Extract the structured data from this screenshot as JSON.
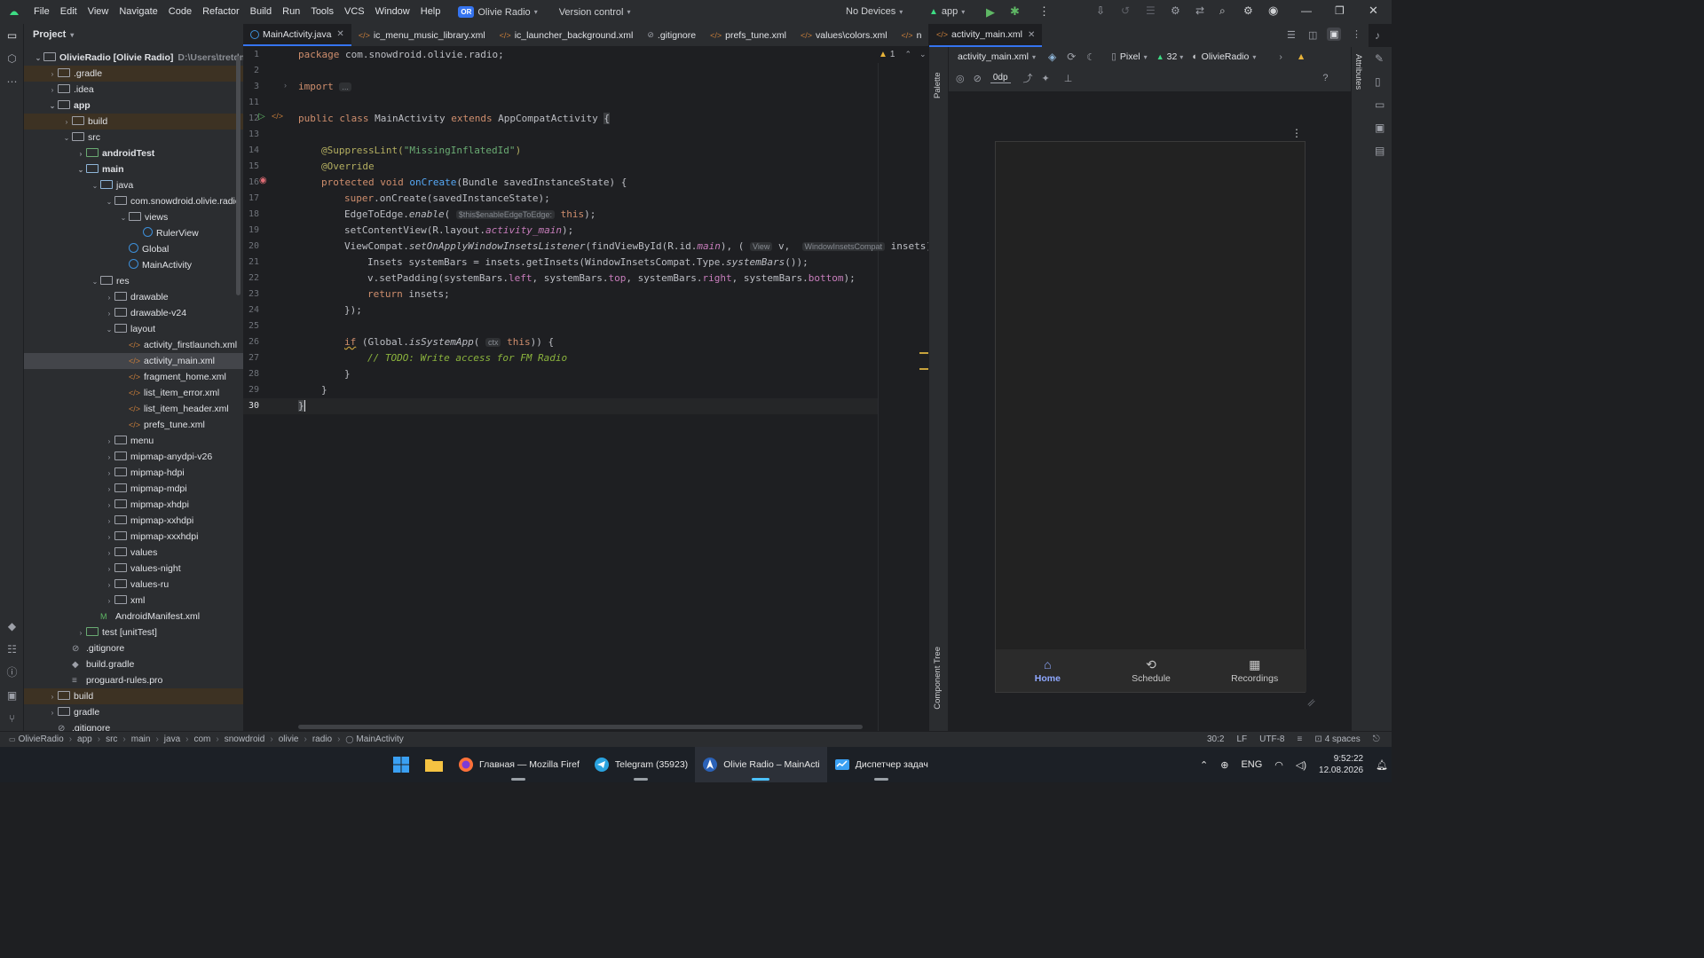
{
  "menu": [
    "File",
    "Edit",
    "View",
    "Navigate",
    "Code",
    "Refactor",
    "Build",
    "Run",
    "Tools",
    "VCS",
    "Window",
    "Help"
  ],
  "project_badge": "OR",
  "project_name": "Olivie Radio",
  "version_control": "Version control",
  "devices": "No Devices",
  "run_config": "app",
  "project_panel": {
    "title": "Project",
    "rows": [
      {
        "label": "OlivieRadio [Olivie Radio]",
        "extra": "D:\\Users\\tretdm\\So"
      },
      {
        "label": ".gradle"
      },
      {
        "label": ".idea"
      },
      {
        "label": "app"
      },
      {
        "label": "build"
      },
      {
        "label": "src"
      },
      {
        "label": "androidTest"
      },
      {
        "label": "main"
      },
      {
        "label": "java"
      },
      {
        "label": "com.snowdroid.olivie.radio"
      },
      {
        "label": "views"
      },
      {
        "label": "RulerView"
      },
      {
        "label": "Global"
      },
      {
        "label": "MainActivity"
      },
      {
        "label": "res"
      },
      {
        "label": "drawable"
      },
      {
        "label": "drawable-v24"
      },
      {
        "label": "layout"
      },
      {
        "label": "activity_firstlaunch.xml"
      },
      {
        "label": "activity_main.xml"
      },
      {
        "label": "fragment_home.xml"
      },
      {
        "label": "list_item_error.xml"
      },
      {
        "label": "list_item_header.xml"
      },
      {
        "label": "prefs_tune.xml"
      },
      {
        "label": "menu"
      },
      {
        "label": "mipmap-anydpi-v26"
      },
      {
        "label": "mipmap-hdpi"
      },
      {
        "label": "mipmap-mdpi"
      },
      {
        "label": "mipmap-xhdpi"
      },
      {
        "label": "mipmap-xxhdpi"
      },
      {
        "label": "mipmap-xxxhdpi"
      },
      {
        "label": "values"
      },
      {
        "label": "values-night"
      },
      {
        "label": "values-ru"
      },
      {
        "label": "xml"
      },
      {
        "label": "AndroidManifest.xml"
      },
      {
        "label": "test [unitTest]"
      },
      {
        "label": ".gitignore"
      },
      {
        "label": "build.gradle"
      },
      {
        "label": "proguard-rules.pro"
      },
      {
        "label": "build"
      },
      {
        "label": "gradle"
      },
      {
        "label": ".gitignore"
      }
    ]
  },
  "editor_tabs": [
    "MainActivity.java",
    "ic_menu_music_library.xml",
    "ic_launcher_background.xml",
    ".gitignore",
    "prefs_tune.xml",
    "values\\colors.xml",
    "n"
  ],
  "editor": {
    "warning_count": "1",
    "line_numbers": [
      "1",
      "2",
      "3",
      "11",
      "12",
      "13",
      "14",
      "15",
      "16",
      "17",
      "18",
      "19",
      "20",
      "21",
      "22",
      "23",
      "24",
      "25",
      "26",
      "27",
      "28",
      "29",
      "30"
    ],
    "code": {
      "l1_kw": "package",
      "l1_rest": " com.snowdroid.olivie.radio;",
      "l3_kw": "import",
      "l3_fold": "...",
      "l12_kw1": "public class",
      "l12_name": " MainActivity ",
      "l12_kw2": "extends",
      "l12_rest": " AppCompatActivity ",
      "l12_brace": "{",
      "l14_ann": "@SuppressLint(",
      "l14_str": "\"MissingInflatedId\"",
      "l14_close": ")",
      "l15_ann": "@Override",
      "l16_kw": "protected void ",
      "l16_fn": "onCreate",
      "l16_rest": "(Bundle savedInstanceState) {",
      "l17_kw": "super",
      "l17_rest": ".onCreate(savedInstanceState);",
      "l18_a": "EdgeToEdge.",
      "l18_fn": "enable",
      "l18_b": "( ",
      "l18_hint": "$this$enableEdgeToEdge:",
      "l18_kw": " this",
      "l18_c": ");",
      "l19_a": "setContentView(R.layout.",
      "l19_fld": "activity_main",
      "l19_b": ");",
      "l20_a": "ViewCompat.",
      "l20_fn": "setOnApplyWindowInsetsListener",
      "l20_b": "(findViewById(R.id.",
      "l20_fld": "main",
      "l20_c": "), ( ",
      "l20_hint1": "View",
      "l20_d": " v,  ",
      "l20_hint2": "WindowInsetsCompat",
      "l20_e": " insets)",
      "l21_a": "Insets systemBars = insets.getInsets(WindowInsetsCompat.Type.",
      "l21_fn": "systemBars",
      "l21_b": "());",
      "l22_a": "v.setPadding(systemBars.",
      "l22_f1": "left",
      "l22_b": ", systemBars.",
      "l22_f2": "top",
      "l22_c": ", systemBars.",
      "l22_f3": "right",
      "l22_d": ", systemBars.",
      "l22_f4": "bottom",
      "l22_e": ");",
      "l23_kw": "return",
      "l23_rest": " insets;",
      "l24": "});",
      "l26_kw": "if",
      "l26_a": " (Global.",
      "l26_fn": "isSystemApp",
      "l26_b": "( ",
      "l26_hint": "ctx",
      "l26_kw2": " this",
      "l26_c": ")) {",
      "l27_cmt": "// ",
      "l27_todo": "TODO: Write access for FM Radio",
      "l28": "}",
      "l29": "}",
      "l30": "}"
    }
  },
  "design": {
    "tab": "activity_main.xml",
    "file_select": "activity_main.xml",
    "device": "Pixel",
    "api": "32",
    "theme": "OlivieRadio",
    "margin": "0dp",
    "palette_label": "Palette",
    "component_tree_label": "Component Tree",
    "attributes_label": "Attributes",
    "nav": [
      {
        "label": "Home",
        "icon": "home-icon"
      },
      {
        "label": "Schedule",
        "icon": "history-icon"
      },
      {
        "label": "Recordings",
        "icon": "library-icon"
      }
    ]
  },
  "statusbar": {
    "crumbs": [
      "OlivieRadio",
      "app",
      "src",
      "main",
      "java",
      "com",
      "snowdroid",
      "olivie",
      "radio",
      "MainActivity"
    ],
    "position": "30:2",
    "line_sep": "LF",
    "encoding": "UTF-8",
    "indent": "4 spaces"
  },
  "taskbar": {
    "apps": [
      {
        "label": "Главная — Mozilla Firef",
        "icon": "firefox-icon"
      },
      {
        "label": "Telegram (35923)",
        "icon": "telegram-icon"
      },
      {
        "label": "Olivie Radio – MainActi",
        "icon": "android-studio-icon"
      },
      {
        "label": "Диспетчер задач",
        "icon": "task-manager-icon"
      }
    ],
    "lang": "ENG",
    "time": "9:52:22",
    "date": "12.08.2026"
  },
  "colors": {
    "accent": "#3574f0",
    "background": "#1e1f22",
    "panel": "#2b2d30"
  }
}
